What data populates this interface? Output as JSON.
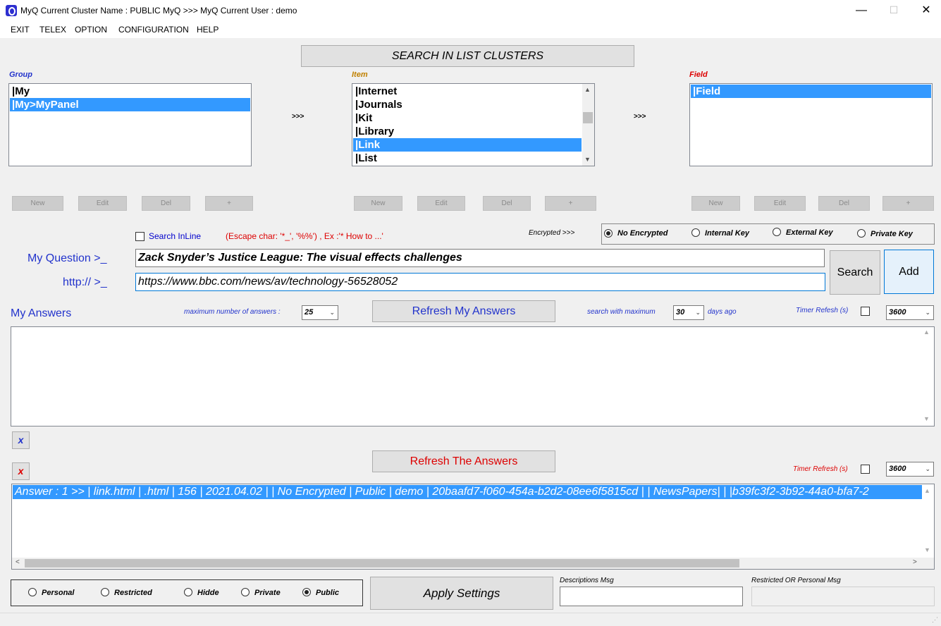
{
  "window": {
    "title": "MyQ Current Cluster Name : PUBLIC MyQ >>> MyQ Current User : demo",
    "min": "—",
    "max": "☐",
    "close": "✕"
  },
  "menu": [
    "EXIT",
    "TELEX",
    "OPTION",
    "CONFIGURATION",
    "HELP"
  ],
  "search_clusters_button": "SEARCH IN LIST CLUSTERS",
  "group": {
    "label": "Group",
    "items": [
      "|My",
      "|My>MyPanel"
    ],
    "selected": 1,
    "buttons": [
      "New",
      "Edit",
      "Del",
      "+"
    ]
  },
  "item": {
    "label": "Item",
    "items": [
      "|Internet",
      "|Journals",
      "|Kit",
      "|Library",
      "|Link",
      "|List"
    ],
    "selected": 4,
    "buttons": [
      "New",
      "Edit",
      "Del",
      "+"
    ]
  },
  "field": {
    "label": "Field",
    "items": [
      "|Field"
    ],
    "selected": 0,
    "buttons": [
      "New",
      "Edit",
      "Del",
      "+"
    ]
  },
  "arrows": ">>>",
  "search_inline_label": "Search InLine",
  "escape_hint": "(Escape char: '*_', '%%') , Ex :'* How to ...'",
  "encrypted_label": "Encrypted >>>",
  "encryption_options": [
    "No Encrypted",
    "Internal Key",
    "External Key",
    "Private Key"
  ],
  "encryption_selected": 0,
  "question_label": "My Question >_",
  "question_value": "Zack Snyder’s Justice League: The visual effects challenges",
  "url_label": "http:// >_",
  "url_value": "https://www.bbc.com/news/av/technology-56528052",
  "search_button": "Search",
  "add_button": "Add",
  "my_answers_label": "My Answers",
  "max_answers_label": "maximum number of answers :",
  "max_answers_value": "25",
  "refresh_my_answers": "Refresh My Answers",
  "search_max_label": "search with maximum",
  "days_value": "30",
  "days_ago_label": "days ago",
  "timer_refresh_label": "Timer Refesh (s)",
  "timer_value_1": "3600",
  "clear_button_1": "x",
  "clear_button_2": "x",
  "refresh_the_answers": "Refresh The Answers",
  "timer_refresh_label_2": "Timer Refresh (s)",
  "timer_value_2": "3600",
  "answer_row": "Answer : 1 >> | link.html | .html | 156 | 2021.04.02 |  | No Encrypted | Public | demo | 20baafd7-f060-454a-b2d2-08ee6f5815cd |  | NewsPapers|   | |b39fc3f2-3b92-44a0-bfa7-2",
  "visibility_options": [
    "Personal",
    "Restricted",
    "Hidde",
    "Private",
    "Public"
  ],
  "visibility_selected": 4,
  "apply_settings": "Apply Settings",
  "descriptions_msg_label": "Descriptions Msg",
  "restricted_msg_label": "Restricted OR Personal Msg",
  "colors": {
    "selection": "#3399ff",
    "link_blue": "#0000cc",
    "alert_red": "#dd0000",
    "item_label": "#c08000"
  }
}
